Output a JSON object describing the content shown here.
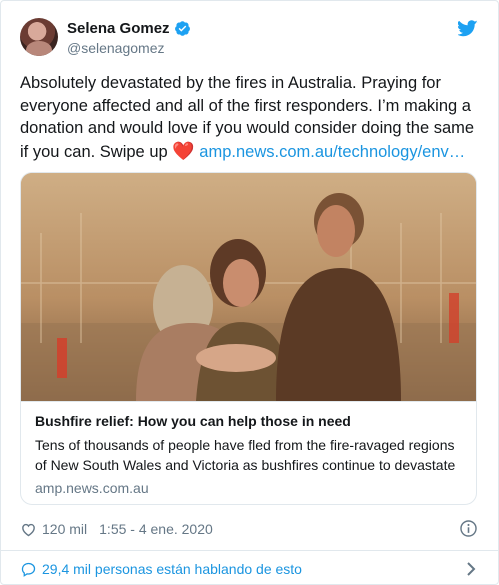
{
  "author": {
    "name": "Selena Gomez",
    "handle": "@selenagomez",
    "verified": true
  },
  "tweet": {
    "text_main": "Absolutely devastated by the fires in Australia. Praying for everyone affected and all of the first responders. I’m making a donation and would love if you would consider doing the same if you can. Swipe up",
    "emoji": "❤️",
    "link_text": "amp.news.com.au/technology/env…"
  },
  "link_card": {
    "title": "Bushfire relief: How you can help those in need",
    "description": "Tens of thousands of people have fled from the fire-ravaged regions of New South Wales and Victoria as bushfires continue to devastate",
    "domain": "amp.news.com.au"
  },
  "meta": {
    "likes": "120 mil",
    "timestamp": "1:55 - 4 ene. 2020"
  },
  "conversation": {
    "label": "29,4 mil personas están hablando de esto"
  },
  "colors": {
    "twitter_blue": "#1da1f2",
    "link_blue": "#1b95e0",
    "muted_gray": "#657786",
    "border": "#e1e8ed"
  },
  "icons": [
    "verified-badge-icon",
    "twitter-bird-icon",
    "heart-icon",
    "info-icon",
    "speech-bubble-icon",
    "chevron-right-icon"
  ]
}
